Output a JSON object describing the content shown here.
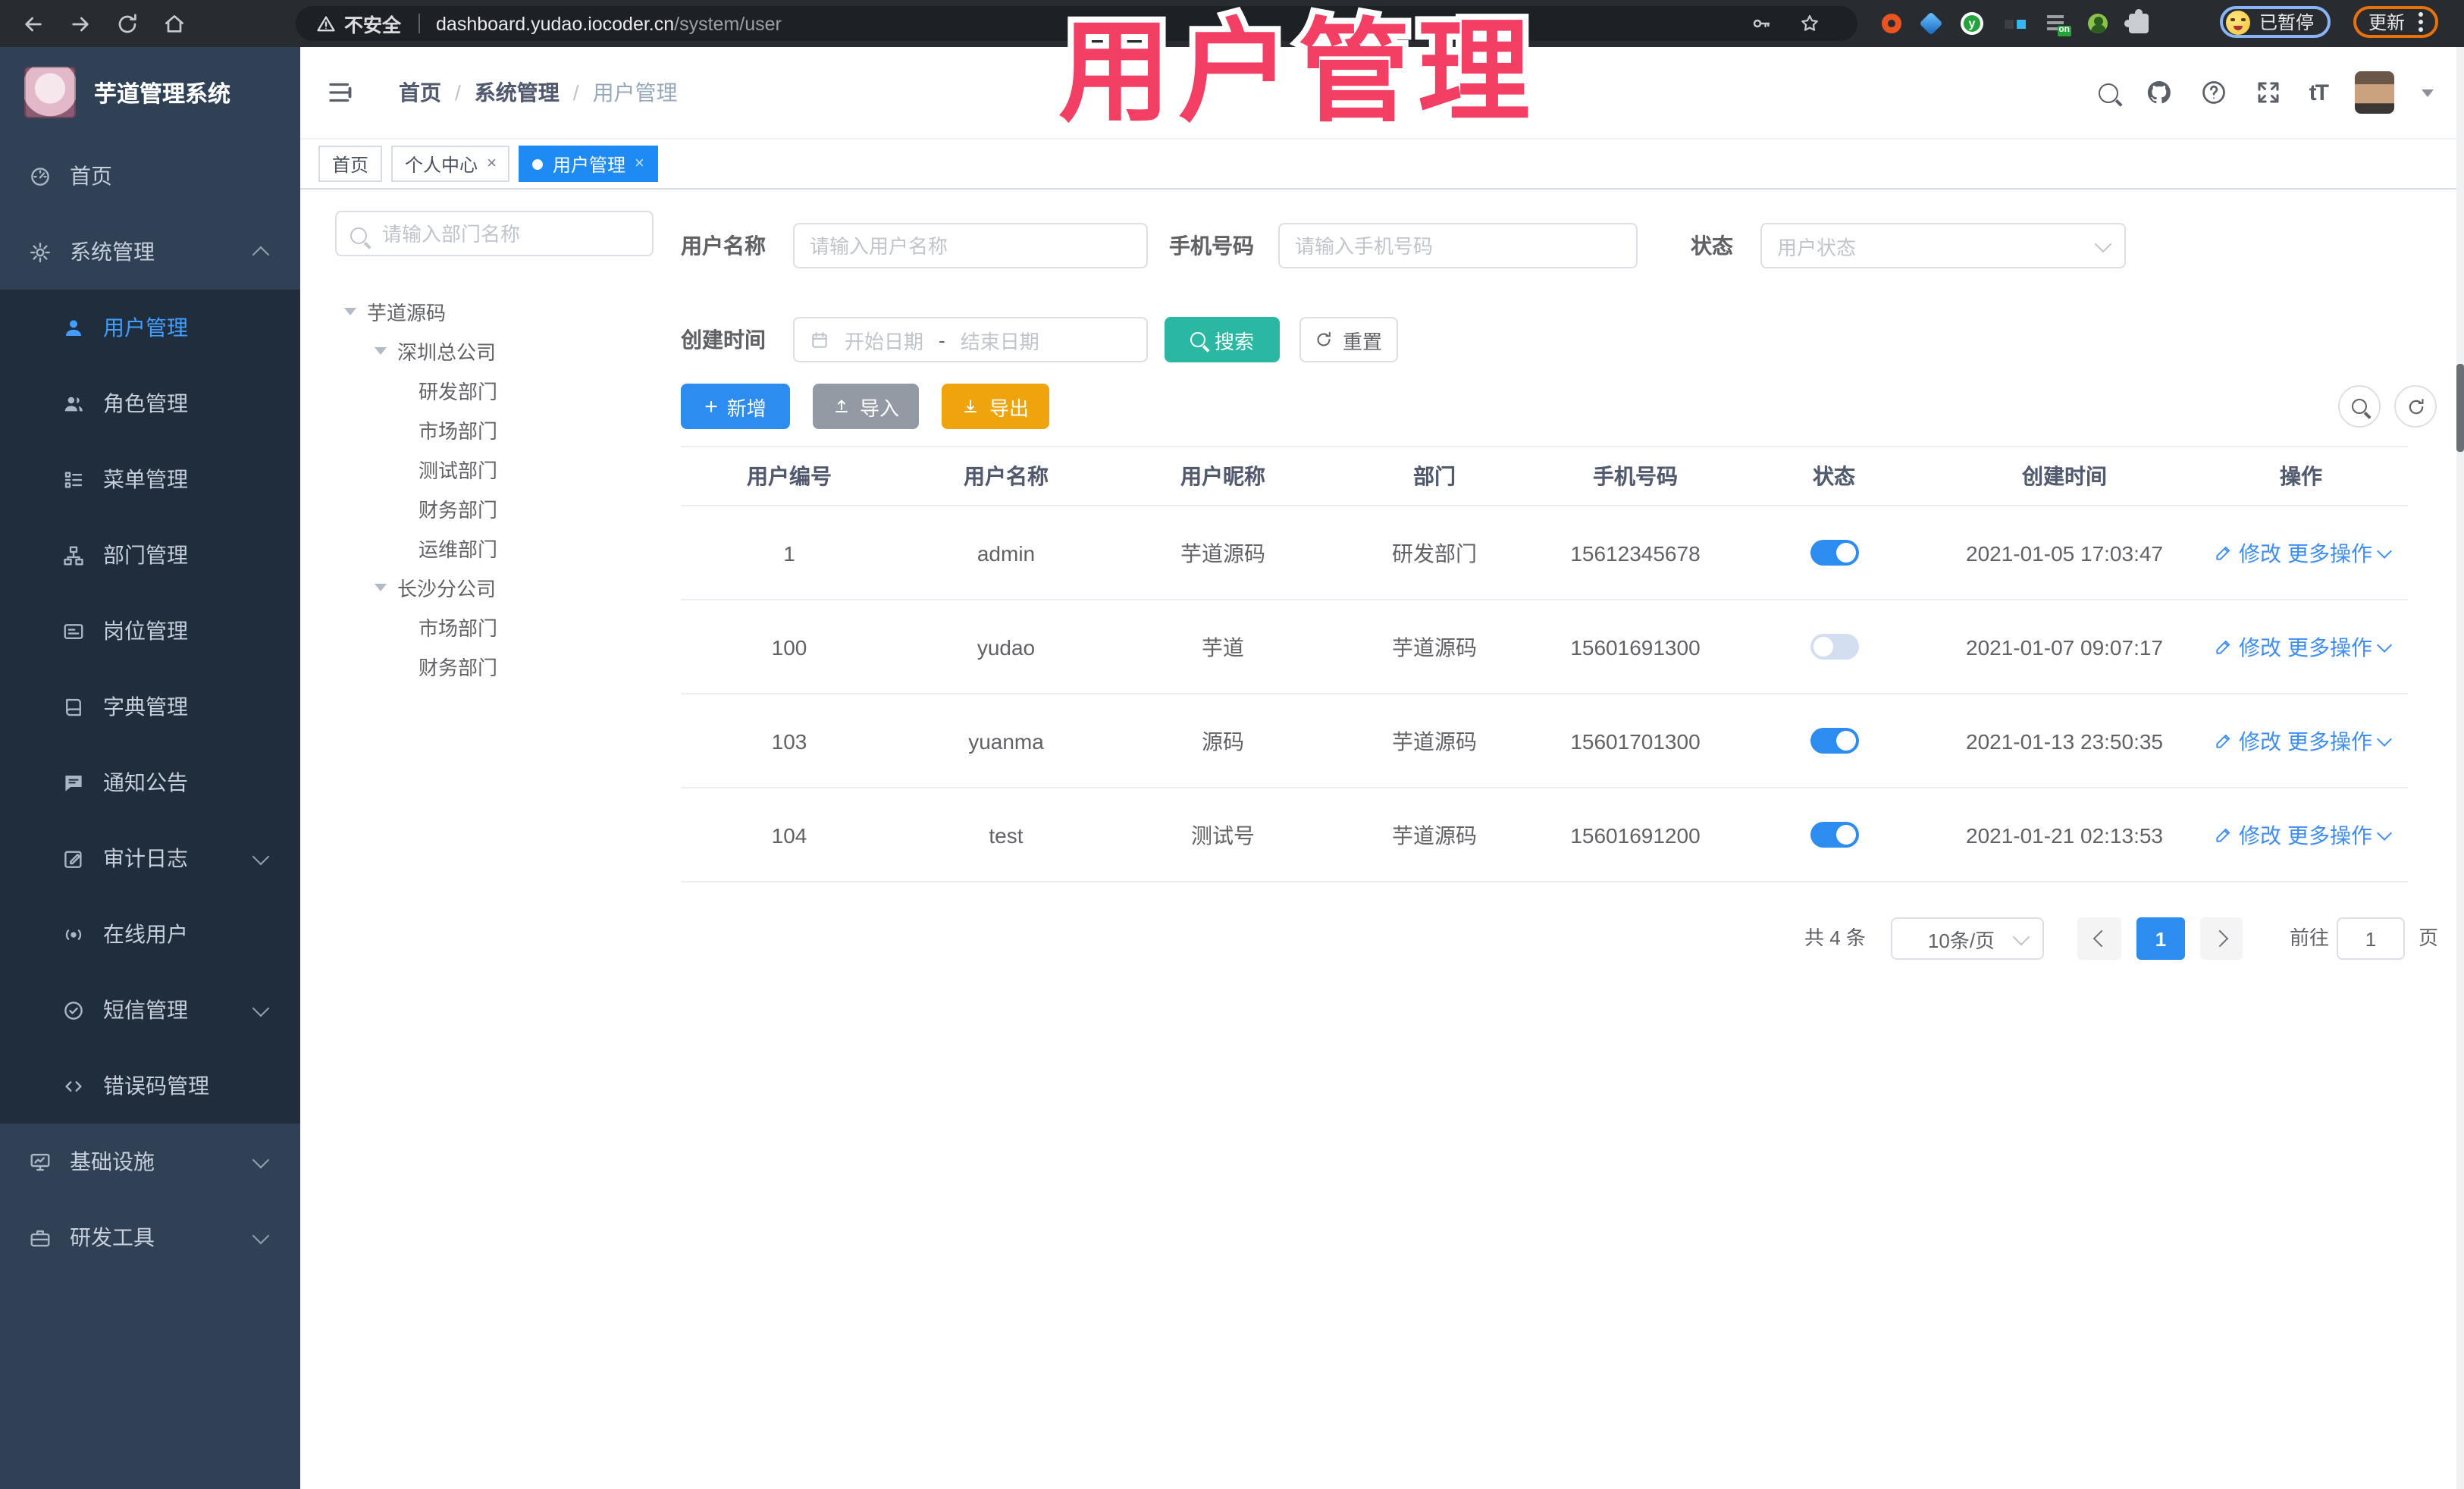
{
  "browser": {
    "security_label": "不安全",
    "url_host": "dashboard.yudao.iocoder.cn",
    "url_path": "/system/user",
    "profile_status": "已暂停",
    "update_label": "更新"
  },
  "overlay_title": "用户管理",
  "sidebar": {
    "app_title": "芋道管理系统",
    "nav": [
      {
        "icon": "dashboard-icon",
        "label": "首页"
      },
      {
        "icon": "gear-icon",
        "label": "系统管理",
        "chevron": "up"
      },
      {
        "group": [
          {
            "icon": "user-icon",
            "label": "用户管理",
            "active": true
          },
          {
            "icon": "users-icon",
            "label": "角色管理"
          },
          {
            "icon": "menu-list-icon",
            "label": "菜单管理"
          },
          {
            "icon": "org-tree-icon",
            "label": "部门管理"
          },
          {
            "icon": "postcard-icon",
            "label": "岗位管理"
          },
          {
            "icon": "dictionary-icon",
            "label": "字典管理"
          },
          {
            "icon": "announcement-icon",
            "label": "通知公告"
          },
          {
            "icon": "audit-log-icon",
            "label": "审计日志",
            "chevron": "down"
          },
          {
            "icon": "online-users-icon",
            "label": "在线用户"
          },
          {
            "icon": "sms-icon",
            "label": "短信管理",
            "chevron": "down"
          },
          {
            "icon": "error-code-icon",
            "label": "错误码管理"
          }
        ]
      },
      {
        "icon": "infrastructure-icon",
        "label": "基础设施",
        "chevron": "down"
      },
      {
        "icon": "dev-tools-icon",
        "label": "研发工具",
        "chevron": "down"
      }
    ]
  },
  "header": {
    "breadcrumb": [
      "首页",
      "系统管理",
      "用户管理"
    ],
    "font_size_icon_label": "tT"
  },
  "tabs": [
    {
      "label": "首页",
      "closable": false,
      "active": false
    },
    {
      "label": "个人中心",
      "closable": true,
      "active": false
    },
    {
      "label": "用户管理",
      "closable": true,
      "active": true
    }
  ],
  "dept": {
    "search_placeholder": "请输入部门名称",
    "tree": [
      {
        "label": "芋道源码",
        "level": 0,
        "caret": true
      },
      {
        "label": "深圳总公司",
        "level": 1,
        "caret": true
      },
      {
        "label": "研发部门",
        "level": 2,
        "caret": false
      },
      {
        "label": "市场部门",
        "level": 2,
        "caret": false
      },
      {
        "label": "测试部门",
        "level": 2,
        "caret": false
      },
      {
        "label": "财务部门",
        "level": 2,
        "caret": false
      },
      {
        "label": "运维部门",
        "level": 2,
        "caret": false
      },
      {
        "label": "长沙分公司",
        "level": 1,
        "caret": true
      },
      {
        "label": "市场部门",
        "level": 2,
        "caret": false
      },
      {
        "label": "财务部门",
        "level": 2,
        "caret": false
      }
    ]
  },
  "filters": {
    "username_label": "用户名称",
    "username_placeholder": "请输入用户名称",
    "mobile_label": "手机号码",
    "mobile_placeholder": "请输入手机号码",
    "status_label": "状态",
    "status_placeholder": "用户状态",
    "created_label": "创建时间",
    "start_placeholder": "开始日期",
    "range_separator": "-",
    "end_placeholder": "结束日期",
    "search_label": "搜索",
    "reset_label": "重置"
  },
  "toolbar": {
    "add_label": "新增",
    "import_label": "导入",
    "export_label": "导出"
  },
  "table": {
    "columns": [
      "用户编号",
      "用户名称",
      "用户昵称",
      "部门",
      "手机号码",
      "状态",
      "创建时间",
      "操作"
    ],
    "rows": [
      {
        "id": "1",
        "username": "admin",
        "nickname": "芋道源码",
        "dept": "研发部门",
        "mobile": "15612345678",
        "status_on": true,
        "created": "2021-01-05 17:03:47"
      },
      {
        "id": "100",
        "username": "yudao",
        "nickname": "芋道",
        "dept": "芋道源码",
        "mobile": "15601691300",
        "status_on": false,
        "created": "2021-01-07 09:07:17"
      },
      {
        "id": "103",
        "username": "yuanma",
        "nickname": "源码",
        "dept": "芋道源码",
        "mobile": "15601701300",
        "status_on": true,
        "created": "2021-01-13 23:50:35"
      },
      {
        "id": "104",
        "username": "test",
        "nickname": "测试号",
        "dept": "芋道源码",
        "mobile": "15601691200",
        "status_on": true,
        "created": "2021-01-21 02:13:53"
      }
    ],
    "edit_label": "修改",
    "more_label": "更多操作"
  },
  "pagination": {
    "total_label": "共 4 条",
    "page_size_label": "10条/页",
    "current_page": "1",
    "goto_label": "前往",
    "goto_value": "1",
    "unit_label": "页"
  },
  "colors": {
    "primary_blue": "#2d8cf0",
    "active_tag_blue": "#1d8bf3",
    "search_teal": "#2bb8a3",
    "export_orange": "#efa30d",
    "import_grey": "#939aa3",
    "overlay_pink": "#f43f65",
    "sidebar_bg": "#304156",
    "submenu_bg": "#1f2d3d"
  }
}
